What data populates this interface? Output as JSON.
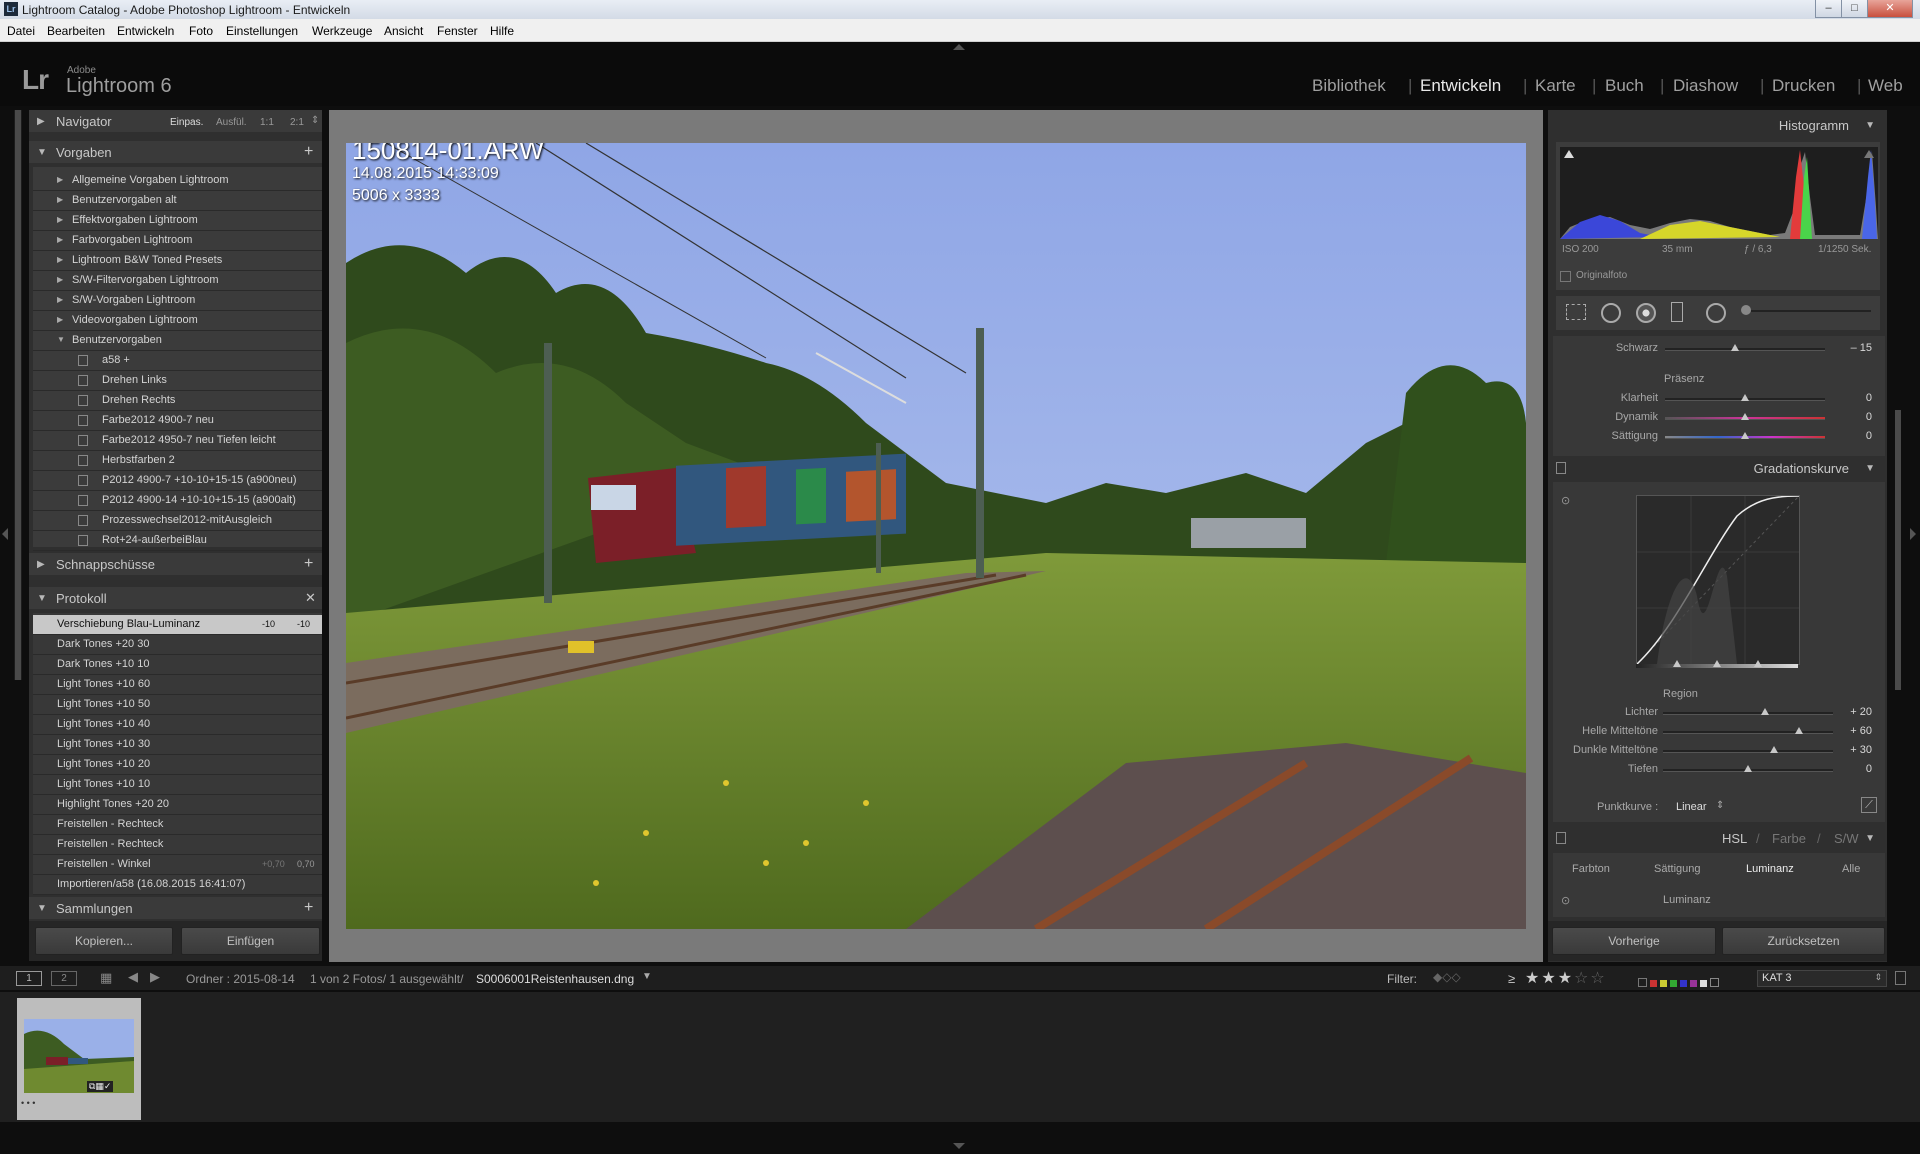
{
  "window": {
    "title": "Lightroom Catalog - Adobe Photoshop Lightroom - Entwickeln",
    "app_icon": "Lr"
  },
  "menu": [
    "Datei",
    "Bearbeiten",
    "Entwickeln",
    "Foto",
    "Einstellungen",
    "Werkzeuge",
    "Ansicht",
    "Fenster",
    "Hilfe"
  ],
  "identity": {
    "logo": "Lr",
    "adobe": "Adobe",
    "name": "Lightroom 6"
  },
  "modules": [
    "Bibliothek",
    "Entwickeln",
    "Karte",
    "Buch",
    "Diashow",
    "Drucken",
    "Web"
  ],
  "active_module": "Entwickeln",
  "left": {
    "navigator": {
      "title": "Navigator",
      "options": [
        "Einpas.",
        "Ausfül.",
        "1:1",
        "2:1"
      ]
    },
    "presets": {
      "title": "Vorgaben",
      "folders": [
        "Allgemeine Vorgaben Lightroom",
        "Benutzervorgaben alt",
        "Effektvorgaben Lightroom",
        "Farbvorgaben Lightroom",
        "Lightroom B&W Toned Presets",
        "S/W-Filtervorgaben Lightroom",
        "S/W-Vorgaben Lightroom",
        "Videovorgaben Lightroom",
        "Benutzervorgaben"
      ],
      "items": [
        "a58 +",
        "Drehen Links",
        "Drehen Rechts",
        "Farbe2012 4900-7 neu",
        "Farbe2012 4950-7 neu Tiefen leicht",
        "Herbstfarben 2",
        "P2012 4900-7 +10-10+15-15 (a900neu)",
        "P2012 4900-14 +10-10+15-15 (a900alt)",
        "Prozesswechsel2012-mitAusgleich",
        "Rot+24-außerbeiBlau"
      ]
    },
    "snapshots": {
      "title": "Schnappschüsse"
    },
    "history": {
      "title": "Protokoll",
      "items": [
        {
          "label": "Verschiebung Blau-Luminanz",
          "a": "-10",
          "b": "-10",
          "selected": true
        },
        {
          "label": "Dark Tones  +20  30",
          "a": "",
          "b": ""
        },
        {
          "label": "Dark Tones  +10  10",
          "a": "",
          "b": ""
        },
        {
          "label": "Light Tones  +10  60",
          "a": "",
          "b": ""
        },
        {
          "label": "Light Tones  +10  50",
          "a": "",
          "b": ""
        },
        {
          "label": "Light Tones  +10  40",
          "a": "",
          "b": ""
        },
        {
          "label": "Light Tones  +10  30",
          "a": "",
          "b": ""
        },
        {
          "label": "Light Tones  +10  20",
          "a": "",
          "b": ""
        },
        {
          "label": "Light Tones  +10  10",
          "a": "",
          "b": ""
        },
        {
          "label": "Highlight Tones  +20  20",
          "a": "",
          "b": ""
        },
        {
          "label": "Freistellen - Rechteck",
          "a": "",
          "b": ""
        },
        {
          "label": "Freistellen - Rechteck",
          "a": "",
          "b": ""
        },
        {
          "label": "Freistellen - Winkel",
          "a": "+0,70",
          "b": "0,70"
        },
        {
          "label": "Importieren/a58 (16.08.2015 16:41:07)",
          "a": "",
          "b": ""
        }
      ]
    },
    "collections": {
      "title": "Sammlungen"
    },
    "buttons": {
      "copy": "Kopieren...",
      "paste": "Einfügen"
    }
  },
  "photo": {
    "filename": "150814-01.ARW",
    "datetime": "14.08.2015 14:33:09",
    "dimensions": "5006 x 3333"
  },
  "right": {
    "histogram": {
      "title": "Histogramm",
      "iso": "ISO 200",
      "focal": "35 mm",
      "aperture": "ƒ / 6,3",
      "shutter": "1/1250 Sek.",
      "original": "Originalfoto"
    },
    "basic": {
      "schwarz_label": "Schwarz",
      "schwarz_value": "– 15",
      "schwarz_pos": 0.44,
      "presence_title": "Präsenz",
      "presence": [
        {
          "label": "Klarheit",
          "value": "0",
          "pos": 0.5
        },
        {
          "label": "Dynamik",
          "value": "0",
          "pos": 0.5
        },
        {
          "label": "Sättigung",
          "value": "0",
          "pos": 0.5
        }
      ]
    },
    "curve": {
      "title": "Gradationskurve",
      "region_title": "Region",
      "sliders": [
        {
          "label": "Lichter",
          "value": "+ 20",
          "pos": 0.6
        },
        {
          "label": "Helle Mitteltöne",
          "value": "+ 60",
          "pos": 0.8
        },
        {
          "label": "Dunkle Mitteltöne",
          "value": "+ 30",
          "pos": 0.65
        },
        {
          "label": "Tiefen",
          "value": "0",
          "pos": 0.5
        }
      ],
      "punkt_label": "Punktkurve :",
      "punkt_value": "Linear"
    },
    "hsl": {
      "tabs_head": [
        "HSL",
        "Farbe",
        "S/W"
      ],
      "subtabs": [
        "Farbton",
        "Sättigung",
        "Luminanz",
        "Alle"
      ],
      "active": "Luminanz",
      "section": "Luminanz"
    },
    "buttons": {
      "prev": "Vorherige",
      "reset": "Zurücksetzen"
    }
  },
  "filmstrip": {
    "views": [
      "1",
      "2"
    ],
    "folder": "Ordner : 2015-08-14",
    "count": "1 von 2 Fotos/ 1 ausgewählt/",
    "file": "S0006001Reistenhausen.dng",
    "filter_label": "Filter:",
    "rating_prefix": "≥",
    "stars_filled": 3,
    "stars_total": 5,
    "collection": "KAT 3",
    "thumb_stars": "• • •"
  }
}
